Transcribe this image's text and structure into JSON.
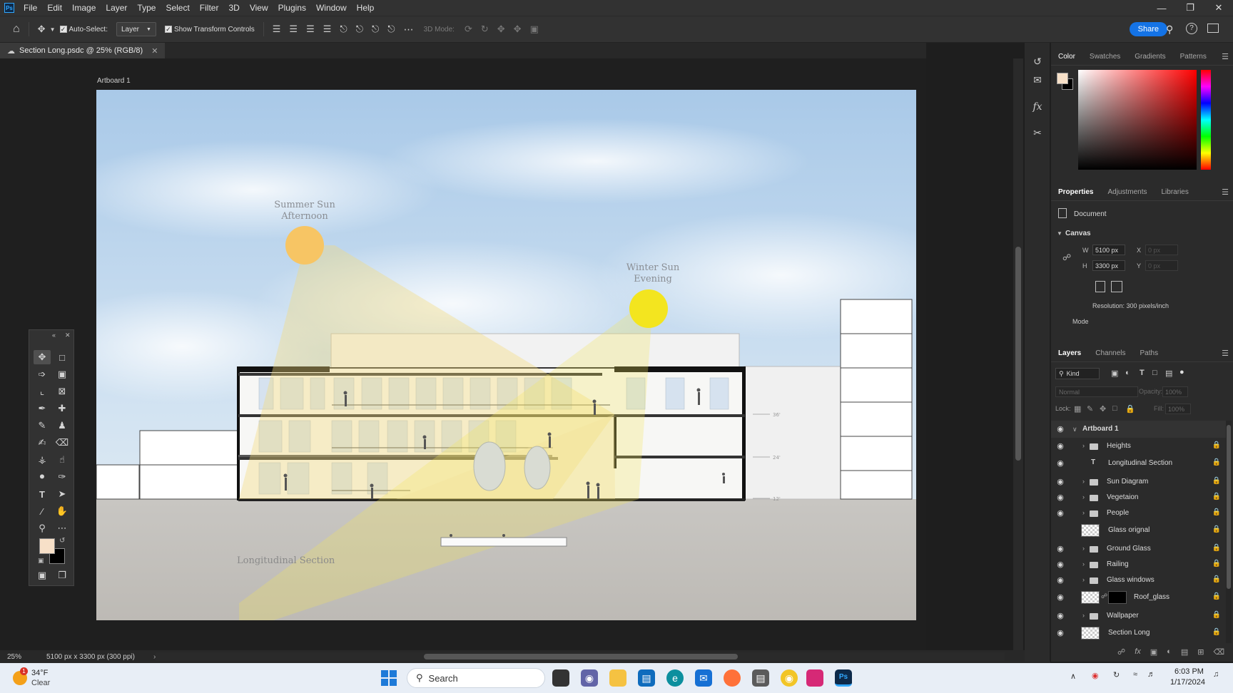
{
  "menubar": {
    "logo": "Ps",
    "items": [
      "File",
      "Edit",
      "Image",
      "Layer",
      "Type",
      "Select",
      "Filter",
      "3D",
      "View",
      "Plugins",
      "Window",
      "Help"
    ]
  },
  "options": {
    "auto_select_label": "Auto-Select:",
    "layer_select_value": "Layer",
    "show_transform_label": "Show Transform Controls",
    "mode_3d_label": "3D Mode:",
    "share_label": "Share"
  },
  "document": {
    "tab_title": "Section Long.psdc @ 25% (RGB/8)",
    "artboard_label": "Artboard 1"
  },
  "drawing": {
    "summer_sun": [
      "Summer Sun",
      "Afternoon"
    ],
    "winter_sun": [
      "Winter Sun",
      "Evening"
    ],
    "caption": "Longitudinal Section",
    "height_marks": [
      "36'",
      "24'",
      "12'"
    ]
  },
  "status": {
    "zoom": "25%",
    "doc_info": "5100 px x 3300 px (300 ppi)"
  },
  "color_panel": {
    "tabs": [
      "Color",
      "Swatches",
      "Gradients",
      "Patterns"
    ],
    "foreground": "#f7e0c8",
    "background": "#000000"
  },
  "properties_panel": {
    "tabs": [
      "Properties",
      "Adjustments",
      "Libraries"
    ],
    "document_label": "Document",
    "canvas_label": "Canvas",
    "w_label": "W",
    "w_value": "5100 px",
    "h_label": "H",
    "h_value": "3300 px",
    "x_label": "X",
    "x_value": "0 px",
    "y_label": "Y",
    "y_value": "0 px",
    "resolution": "Resolution: 300 pixels/inch",
    "mode_label": "Mode"
  },
  "layers_panel": {
    "tabs": [
      "Layers",
      "Channels",
      "Paths"
    ],
    "kind_label": "Kind",
    "blend_mode": "Normal",
    "opacity_label": "Opacity:",
    "opacity_value": "100%",
    "lock_label": "Lock:",
    "fill_label": "Fill:",
    "fill_value": "100%",
    "artboard_name": "Artboard 1",
    "layers": [
      {
        "name": "Heights",
        "type": "folder",
        "visible": true
      },
      {
        "name": "Longitudinal Section",
        "type": "text",
        "visible": true
      },
      {
        "name": "Sun Diagram",
        "type": "folder",
        "visible": true
      },
      {
        "name": "Vegetaion",
        "type": "folder",
        "visible": true
      },
      {
        "name": "People",
        "type": "folder",
        "visible": true
      },
      {
        "name": "Glass orignal",
        "type": "image",
        "visible": false
      },
      {
        "name": "Ground Glass",
        "type": "folder",
        "visible": true
      },
      {
        "name": "Railing",
        "type": "folder",
        "visible": true
      },
      {
        "name": "Glass windows",
        "type": "folder",
        "visible": true
      },
      {
        "name": "Roof_glass",
        "type": "masked",
        "visible": true
      },
      {
        "name": "Wallpaper",
        "type": "folder",
        "visible": true
      },
      {
        "name": "Section Long",
        "type": "image",
        "visible": true
      }
    ]
  },
  "taskbar": {
    "weather_temp": "34°F",
    "weather_cond": "Clear",
    "weather_badge": "1",
    "search_label": "Search",
    "time": "6:03 PM",
    "date": "1/17/2024"
  }
}
